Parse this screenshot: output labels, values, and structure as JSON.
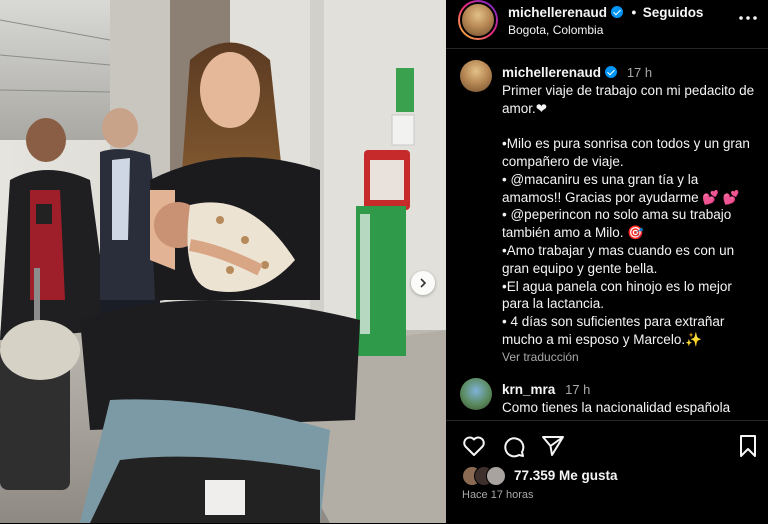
{
  "post": {
    "username": "michellerenaud",
    "follow_status": "Seguidos",
    "separator": "•",
    "location": "Bogota, Colombia",
    "more_icon": "more-horizontal-icon",
    "verified_icon": "verified-badge-icon"
  },
  "caption": {
    "username": "michellerenaud",
    "time": "17 h",
    "lines": [
      "Primer viaje de trabajo con mi pedacito de amor.❤",
      "",
      "•Milo es pura sonrisa con todos y un gran compañero de viaje.",
      "• @macaniru es una gran tía y la amamos!! Gracias por ayudarme 💕 💕",
      "• @peperincon no solo ama su trabajo también amo a Milo. 🎯",
      "•Amo trabajar y mas cuando es con un gran equipo y gente bella.",
      "•El agua panela con hinojo es lo mejor para la lactancia.",
      "• 4 días son suficientes para extrañar mucho a mi esposo y Marcelo.✨"
    ],
    "see_translation": "Ver traducción"
  },
  "comment": {
    "username": "krn_mra",
    "time": "17 h",
    "text": "Como tienes la nacionalidad española"
  },
  "actions": {
    "like_icon": "heart-icon",
    "comment_icon": "comment-icon",
    "share_icon": "send-icon",
    "save_icon": "bookmark-icon"
  },
  "likes": {
    "count_text": "77.359 Me gusta",
    "time_ago": "Hace 17 horas"
  },
  "colors": {
    "background": "#000000",
    "verified": "#0095f6",
    "text": "#f5f5f5",
    "muted": "#a8a8a8"
  }
}
